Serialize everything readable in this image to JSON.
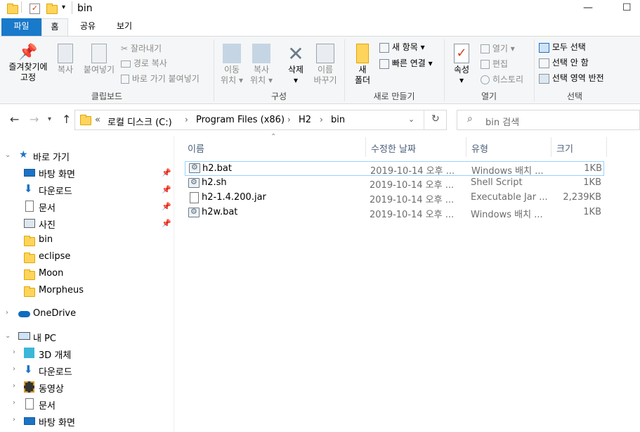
{
  "window": {
    "title": "bin",
    "min": "—",
    "max": "☐"
  },
  "tabs": [
    {
      "label": "파일"
    },
    {
      "label": "홈"
    },
    {
      "label": "공유"
    },
    {
      "label": "보기"
    }
  ],
  "ribbon": {
    "clipboard": {
      "pin": "즐겨찾기에 고정",
      "copy": "복사",
      "paste": "붙여넣기",
      "cut": "잘라내기",
      "copy_path": "경로 복사",
      "paste_shortcut": "바로 가기 붙여넣기",
      "label": "클립보드"
    },
    "organize": {
      "move_line1": "이동",
      "move_line2": "위치",
      "copyto_line1": "복사",
      "copyto_line2": "위치",
      "delete": "삭제",
      "rename_line1": "이름",
      "rename_line2": "바꾸기",
      "label": "구성"
    },
    "new": {
      "new_folder_line1": "새",
      "new_folder_line2": "폴더",
      "new_item": "새 항목",
      "easy_access": "빠른 연결",
      "label": "새로 만들기"
    },
    "open": {
      "properties": "속성",
      "open": "열기",
      "edit": "편집",
      "history": "히스토리",
      "label": "열기"
    },
    "select": {
      "select_all": "모두 선택",
      "select_none": "선택 안 함",
      "invert": "선택 영역 반전",
      "label": "선택"
    }
  },
  "address": {
    "overflow": "«",
    "crumbs": [
      "로컬 디스크 (C:)",
      "Program Files (x86)",
      "H2",
      "bin"
    ],
    "search_placeholder": "bin 검색"
  },
  "navpane": {
    "quick_access": "바로 가기",
    "quick_items": [
      "바탕 화면",
      "다운로드",
      "문서",
      "사진",
      "bin",
      "eclipse",
      "Moon",
      "Morpheus"
    ],
    "onedrive": "OneDrive",
    "this_pc": "내 PC",
    "pc_items": [
      "3D 개체",
      "다운로드",
      "동영상",
      "문서",
      "바탕 화면"
    ]
  },
  "filelist": {
    "columns": {
      "name": "이름",
      "date": "수정한 날짜",
      "type": "유형",
      "size": "크기"
    },
    "files": [
      {
        "name": "h2.bat",
        "date": "2019-10-14 오후 ...",
        "type": "Windows 배치 ...",
        "size": "1KB",
        "icon": "batch-file-icon"
      },
      {
        "name": "h2.sh",
        "date": "2019-10-14 오후 ...",
        "type": "Shell Script",
        "size": "1KB",
        "icon": "script-file-icon"
      },
      {
        "name": "h2-1.4.200.jar",
        "date": "2019-10-14 오후 ...",
        "type": "Executable Jar ...",
        "size": "2,239KB",
        "icon": "blank-file-icon"
      },
      {
        "name": "h2w.bat",
        "date": "2019-10-14 오후 ...",
        "type": "Windows 배치 ...",
        "size": "1KB",
        "icon": "batch-file-icon"
      }
    ]
  }
}
